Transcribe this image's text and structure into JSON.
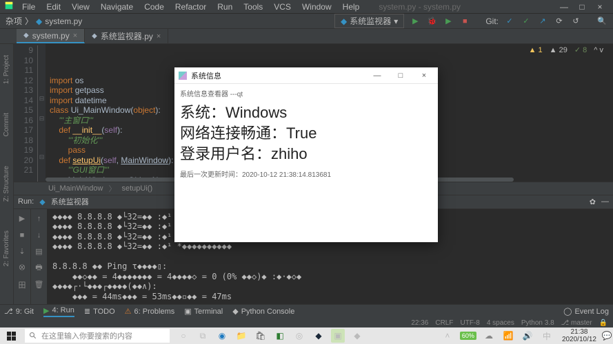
{
  "menubar": {
    "items": [
      "File",
      "Edit",
      "View",
      "Navigate",
      "Code",
      "Refactor",
      "Run",
      "Tools",
      "VCS",
      "Window",
      "Help"
    ],
    "title": "system.py - system.py"
  },
  "window_buttons": {
    "min": "—",
    "max": "□",
    "close": "×"
  },
  "projbar": {
    "crumb_project": "杂项",
    "crumb_file": "system.py",
    "run_config": "系统监视器",
    "git_label": "Git:"
  },
  "tabs": [
    {
      "label": "system.py",
      "active": true
    },
    {
      "label": "系统监视器.py",
      "active": false
    }
  ],
  "gutter": {
    "start": 8,
    "lines": [
      "",
      "9",
      "10",
      "11",
      "12",
      "13",
      "14",
      "15",
      "16",
      "17",
      "18",
      "19",
      "20",
      "21"
    ]
  },
  "code_lines": [
    {
      "tokens": [
        [
          "import ",
          "k-orange"
        ],
        [
          "os",
          ""
        ]
      ]
    },
    {
      "tokens": [
        [
          "import ",
          "k-orange"
        ],
        [
          "getpass",
          ""
        ]
      ]
    },
    {
      "tokens": [
        [
          "import ",
          "k-orange"
        ],
        [
          "datetime",
          ""
        ]
      ]
    },
    {
      "tokens": [
        [
          "",
          ""
        ]
      ]
    },
    {
      "tokens": [
        [
          "",
          ""
        ]
      ]
    },
    {
      "tokens": [
        [
          "class ",
          "k-orange"
        ],
        [
          "Ui_MainWindow",
          ""
        ],
        [
          "(",
          ""
        ],
        [
          "object",
          "k-orange"
        ],
        [
          "):",
          ""
        ]
      ]
    },
    {
      "tokens": [
        [
          "    '''主窗口'''",
          "k-green"
        ]
      ]
    },
    {
      "tokens": [
        [
          "    ",
          ""
        ],
        [
          "def ",
          "k-orange"
        ],
        [
          "__init__",
          "k-yellow"
        ],
        [
          "(",
          ""
        ],
        [
          "self",
          "k-purple"
        ],
        [
          "):",
          ""
        ]
      ]
    },
    {
      "tokens": [
        [
          "        '''初始化'''",
          "k-green"
        ]
      ]
    },
    {
      "tokens": [
        [
          "        ",
          ""
        ],
        [
          "pass",
          "k-orange"
        ]
      ]
    },
    {
      "tokens": [
        [
          "",
          ""
        ]
      ]
    },
    {
      "tokens": [
        [
          "    ",
          ""
        ],
        [
          "def ",
          "k-orange"
        ],
        [
          "setupUi",
          "k-yellow underline"
        ],
        [
          "(",
          ""
        ],
        [
          "self",
          "k-purple"
        ],
        [
          ", ",
          ""
        ],
        [
          "MainWindow",
          "underline"
        ],
        [
          "):",
          ""
        ]
      ]
    },
    {
      "tokens": [
        [
          "        '''GUI窗口'''",
          "k-green"
        ]
      ]
    },
    {
      "tokens": [
        [
          "        MainWindow.setObjectName(",
          ""
        ],
        [
          "\"M",
          "k-str"
        ]
      ]
    }
  ],
  "editor_badges": {
    "warn_icon": "▲",
    "warn": "1",
    "err_icon": "▲",
    "err": "29",
    "ok_icon": "✓",
    "ok": "8",
    "more": "^ v"
  },
  "breadcrumb": {
    "a": "Ui_MainWindow",
    "b": "setupUi()"
  },
  "run_panel": {
    "title_label": "Run:",
    "title_config": "系统监视器",
    "gear": "✿",
    "minus": "—",
    "output_lines": [
      "◆◆◆◆ 8.8.8.8 ◆└32=◆◆ :◆¹ *◆◆◆◆◆◆◆◆◆◆",
      "◆◆◆◆ 8.8.8.8 ◆└32=◆◆ :◆¹ *◆◆◆◆◆◆◆◆◆◆",
      "◆◆◆◆ 8.8.8.8 ◆└32=◆◆ :◆¹ *◆◆◆◆◆◆◆◆◆◆",
      "◆◆◆◆ 8.8.8.8 ◆└32=◆◆ :◆¹ *◆◆◆◆◆◆◆◆◆◆",
      "",
      "8.8.8.8 ◆◆ Ping τ◆◆◆◆▯:",
      "    ◆◆◇◆◆ = 4◆◆◆◆◆◆◆ = 4◆◆◆◆◇ = 0 (0% ◆◆◇)◆ :◆·◆◇◆",
      "◆◆◆◆┌·└◆◆◆┌◆◆◆◆(◆◆∧):",
      "    ◆◆◆ = 44ms◆◆◆ = 53ms◆◆▫◆◆ = 47ms"
    ]
  },
  "bottom_bar": {
    "git": "9: Git",
    "run": "4: Run",
    "todo": "TODO",
    "problems": "6: Problems",
    "terminal": "Terminal",
    "pyconsole": "Python Console",
    "eventlog": "Event Log"
  },
  "status": {
    "pos": "22:36",
    "lf": "CRLF",
    "enc": "UTF-8",
    "indent": "4 spaces",
    "py": "Python 3.8",
    "branch_icon": "⎇",
    "branch": "master",
    "lock": "🔒"
  },
  "dialog": {
    "title": "系统信息",
    "subtitle": "系统信息查看器 ---qt",
    "line1_label": "系统：",
    "line1_value": "Windows",
    "line2_label": "网络连接畅通：",
    "line2_value": "True",
    "line3_label": "登录用户名：",
    "line3_value": "zhiho",
    "footer": "最后一次更新时间：2020-10-12 21:38:14.813681"
  },
  "left_strip": {
    "project": "1: Project",
    "commit": "Commit",
    "structure": "Z: Structure",
    "favorites": "2: Favorites"
  },
  "taskbar": {
    "search_placeholder": "在这里输入你要搜索的内容",
    "battery": "60%",
    "clock_time": "21:38",
    "clock_date": "2020/10/12"
  }
}
